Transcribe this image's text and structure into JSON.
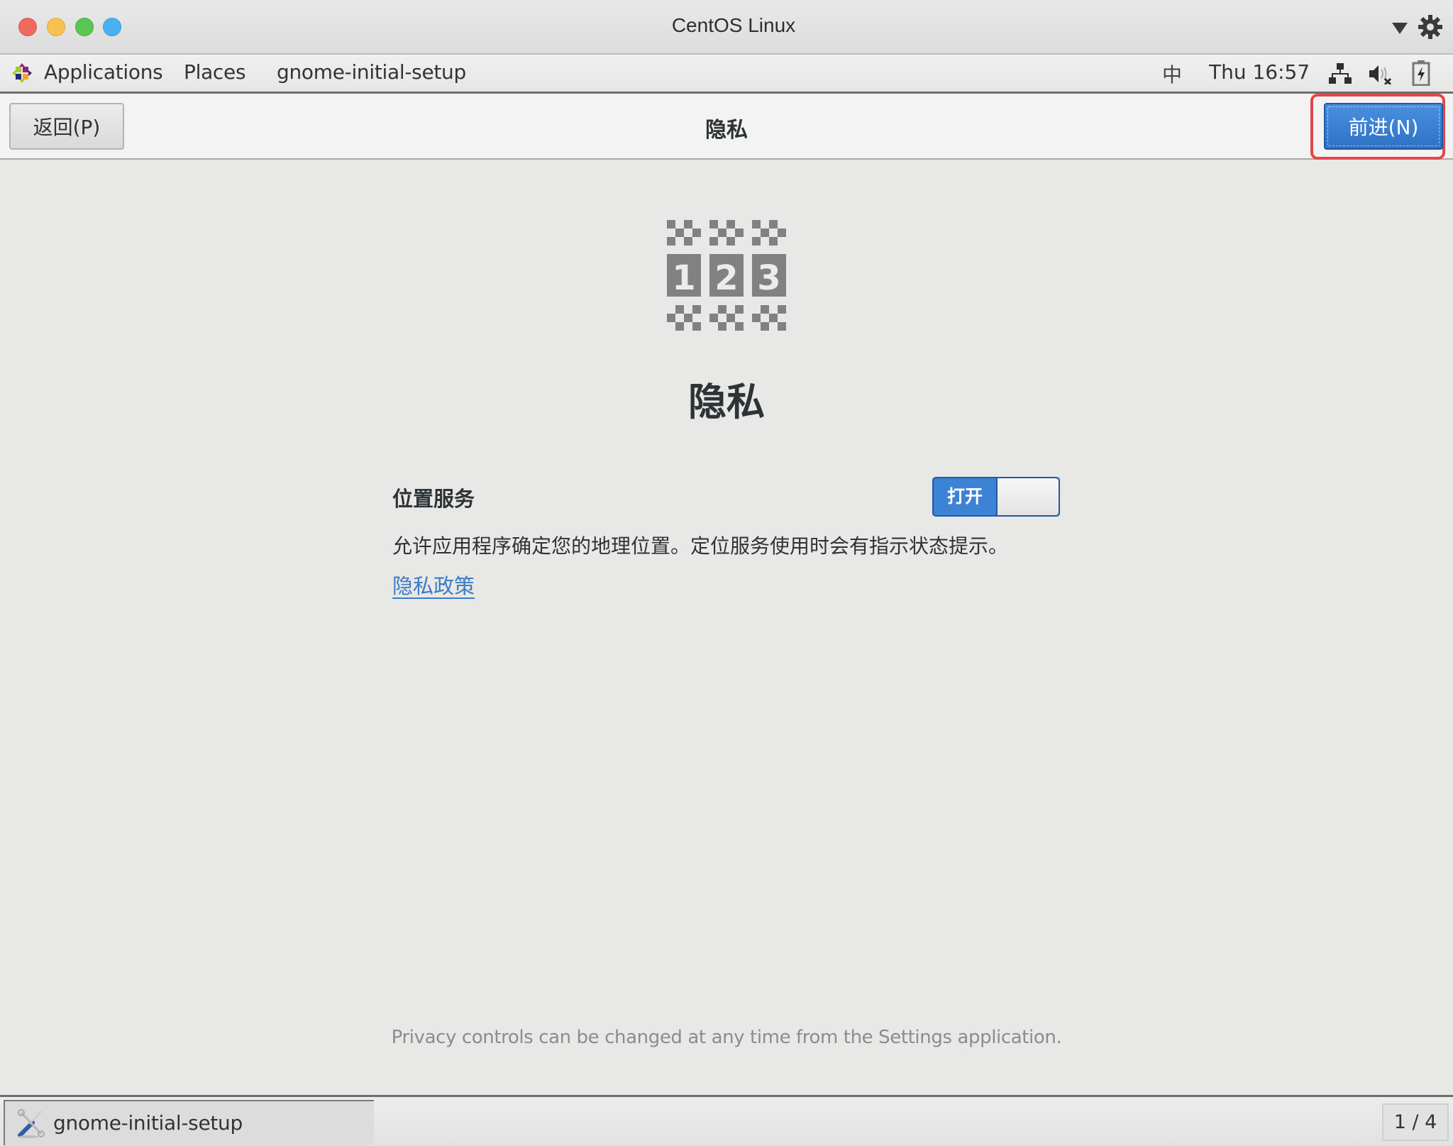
{
  "window": {
    "title": "CentOS Linux",
    "controls": [
      "close",
      "minimize",
      "maximize",
      "fullscreen"
    ]
  },
  "menubar": {
    "logo_icon": "centos-logo",
    "items": [
      {
        "label": "Applications"
      },
      {
        "label": "Places"
      },
      {
        "label": "gnome-initial-setup"
      }
    ],
    "input_method": "中",
    "clock": "Thu 16:57",
    "status_icons": [
      "network-wired-icon",
      "volume-muted-icon",
      "battery-charging-icon"
    ]
  },
  "headerbar": {
    "back_label": "返回(P)",
    "title": "隐私",
    "next_label": "前进(N)",
    "next_highlighted": true
  },
  "content": {
    "icon": "privacy-123-icon",
    "title": "隐私",
    "location_label": "位置服务",
    "location_toggle": {
      "state_label": "打开",
      "on": true
    },
    "location_description": "允许应用程序确定您的地理位置。定位服务使用时会有指示状态提示。",
    "privacy_policy_link": "隐私政策",
    "footer_note": "Privacy controls can be changed at any time from the Settings application."
  },
  "taskbar": {
    "task_label": "gnome-initial-setup",
    "task_icon": "tools-icon",
    "workspace": "1 / 4"
  },
  "colors": {
    "accent": "#3d83d5",
    "highlight": "#e2474a",
    "link": "#3b7cc5"
  }
}
